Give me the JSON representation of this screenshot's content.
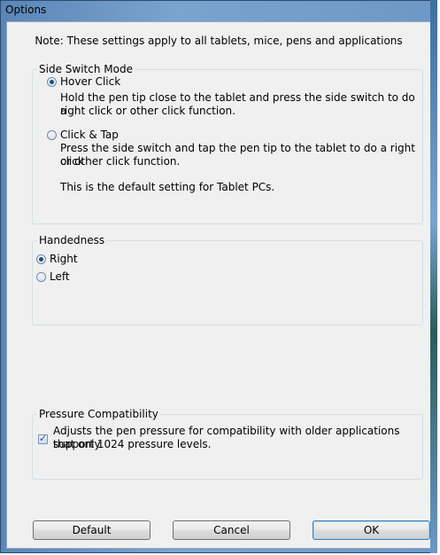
{
  "window": {
    "title": "Options"
  },
  "note": "Note: These settings apply to all tablets, mice, pens and applications",
  "side_switch": {
    "legend": "Side Switch Mode",
    "hover_click": {
      "label": "Hover Click",
      "description_line1": "Hold the pen tip close to the tablet and press the side switch to do a",
      "description_line2": "right click or other click function.",
      "selected": true
    },
    "click_tap": {
      "label": "Click & Tap",
      "description_line1": "Press the side switch and tap the pen tip to the tablet to do a right click",
      "description_line2": "or other click function.",
      "description_line3": "This is the default setting for Tablet PCs.",
      "selected": false
    }
  },
  "handedness": {
    "legend": "Handedness",
    "right": {
      "label": "Right",
      "selected": true
    },
    "left": {
      "label": "Left",
      "selected": false
    }
  },
  "pressure": {
    "legend": "Pressure Compatibility",
    "checkbox_line1": "Adjusts the pen pressure for compatibility with older applications that only",
    "checkbox_line2": "support 1024 pressure levels.",
    "checked": true
  },
  "buttons": {
    "default": "Default",
    "cancel": "Cancel",
    "ok": "OK"
  }
}
